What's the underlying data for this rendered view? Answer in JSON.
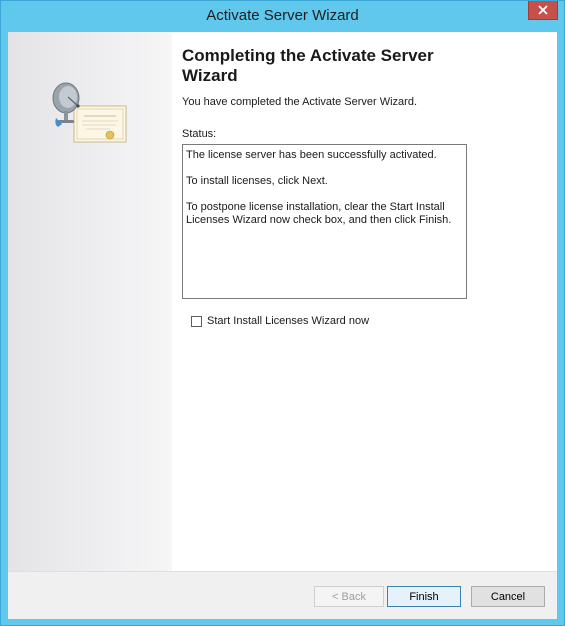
{
  "window": {
    "title": "Activate Server Wizard"
  },
  "content": {
    "heading": "Completing the Activate Server Wizard",
    "subtext": "You have completed the Activate Server Wizard.",
    "status_label": "Status:",
    "status_lines": [
      "The license server has been successfully activated.",
      "To install licenses, click Next.",
      "To postpone license installation, clear the Start Install Licenses Wizard now check box, and then click Finish."
    ],
    "checkbox_label": "Start Install Licenses Wizard now",
    "checkbox_checked": false
  },
  "footer": {
    "back_label": "< Back",
    "finish_label": "Finish",
    "cancel_label": "Cancel"
  },
  "colors": {
    "titlebar": "#5fc8ec",
    "close_button": "#c7504a",
    "footer_bg": "#f0f0f0"
  },
  "icons": {
    "close": "close-icon",
    "wizard_graphic": "satellite-certificate-icon"
  }
}
